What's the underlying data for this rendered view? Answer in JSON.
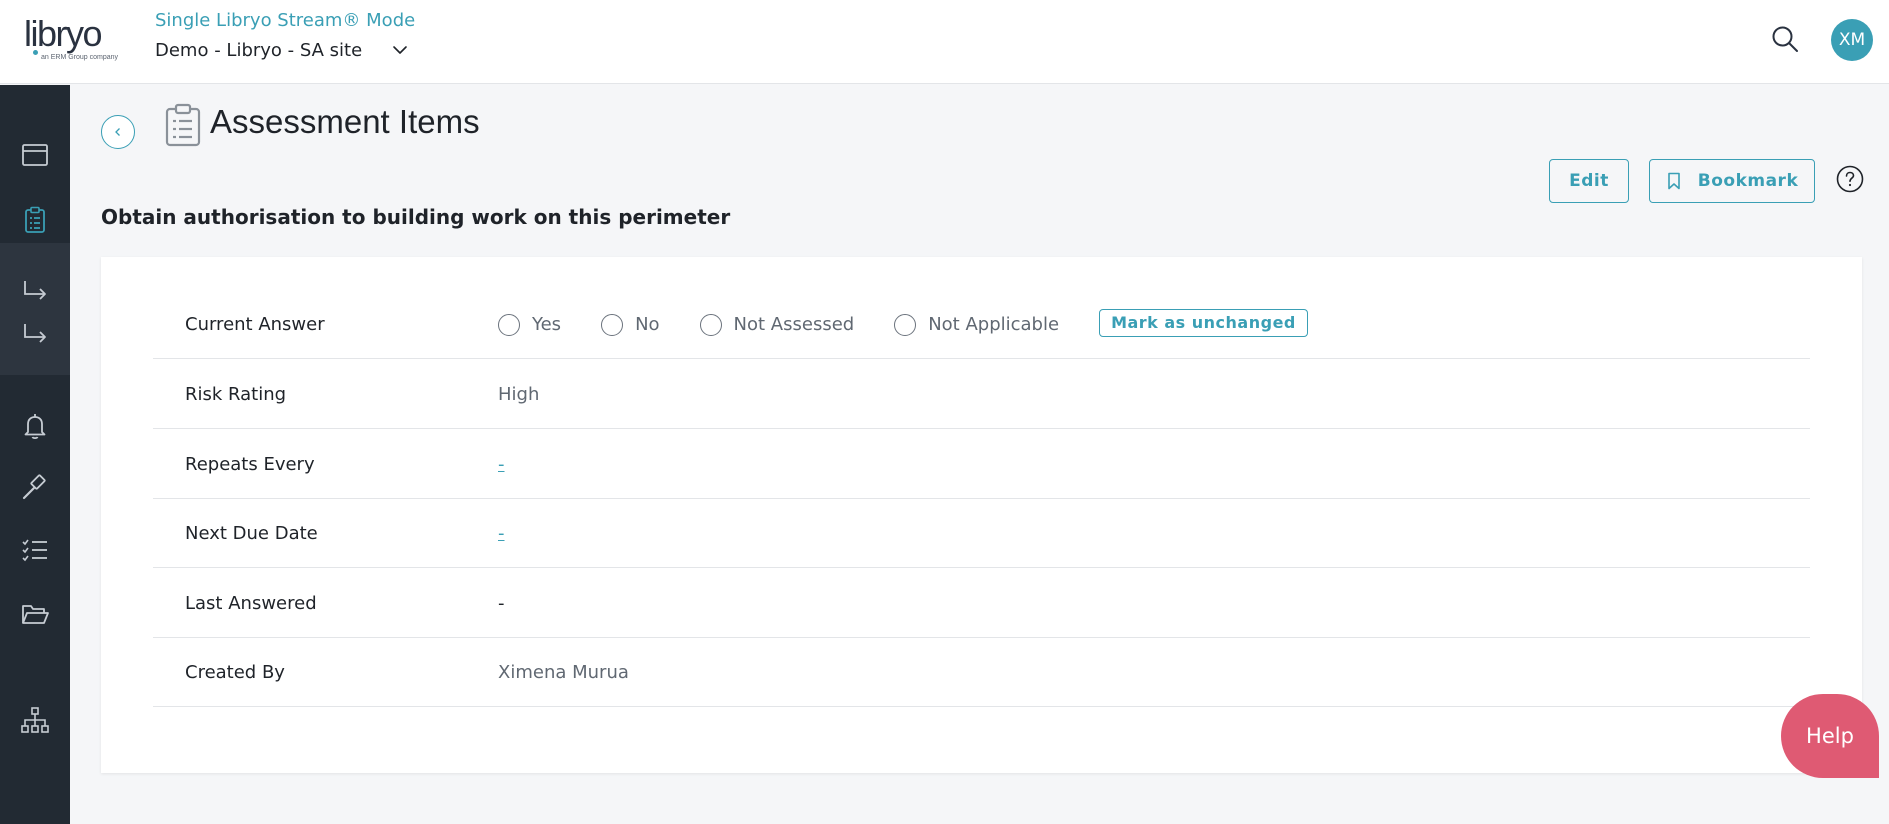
{
  "header": {
    "logo_text": "libryo",
    "logo_subtext": "an ERM Group company",
    "mode_title": "Single Libryo Stream® Mode",
    "stream_name": "Demo - Libryo - SA site",
    "user_initials": "XM"
  },
  "sidebar": {
    "items": [
      {
        "icon": "calendar-icon"
      },
      {
        "icon": "clipboard-icon",
        "active": true
      },
      {
        "icon": "arrow-right-turn-icon"
      },
      {
        "icon": "arrow-right-turn-icon"
      },
      {
        "icon": "bell-icon"
      },
      {
        "icon": "gavel-icon"
      },
      {
        "icon": "checklist-icon"
      },
      {
        "icon": "folder-icon"
      },
      {
        "icon": "hierarchy-icon"
      }
    ]
  },
  "page": {
    "title": "Assessment Items",
    "edit_label": "Edit",
    "bookmark_label": "Bookmark",
    "item_heading": "Obtain authorisation to building work on this perimeter"
  },
  "details": {
    "current_answer": {
      "label": "Current Answer",
      "options": [
        "Yes",
        "No",
        "Not Assessed",
        "Not Applicable"
      ],
      "mark_unchanged_label": "Mark as unchanged"
    },
    "risk_rating": {
      "label": "Risk Rating",
      "value": "High"
    },
    "repeats_every": {
      "label": "Repeats Every",
      "value": "-"
    },
    "next_due_date": {
      "label": "Next Due Date",
      "value": "-"
    },
    "last_answered": {
      "label": "Last Answered",
      "value": "-"
    },
    "created_by": {
      "label": "Created By",
      "value": "Ximena Murua"
    }
  },
  "help_label": "Help",
  "colors": {
    "accent": "#3a9fb5",
    "sidebar_bg": "#222a33",
    "help_bubble": "#df5a73"
  }
}
